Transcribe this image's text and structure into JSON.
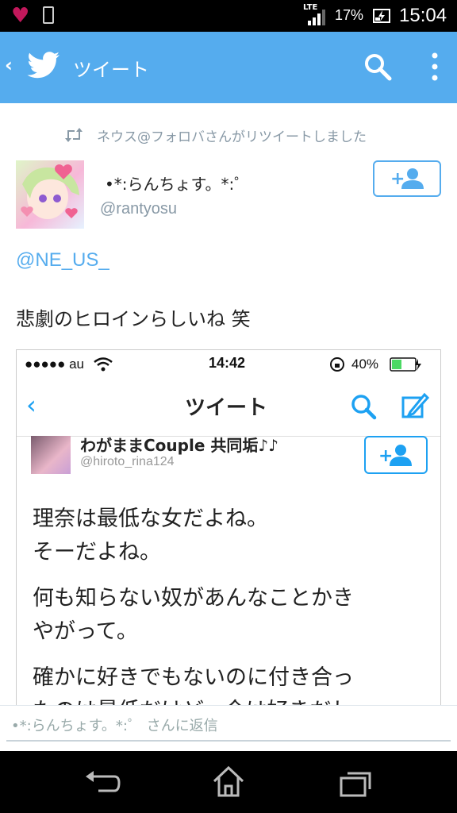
{
  "status_bar": {
    "network": "LTE",
    "battery_percent": "17%",
    "time": "15:04"
  },
  "app_bar": {
    "title": "ツイート",
    "icons": [
      "back-chevron",
      "twitter-bird",
      "search",
      "overflow-menu"
    ]
  },
  "tweet": {
    "retweet_notice": "ネウス@フォロバさんがリツイートしました",
    "display_name": "•*:らんちょす。*:゜",
    "handle": "@rantyosu",
    "mention": "@NE_US_",
    "text": "悲劇のヒロインらしいね 笑"
  },
  "embedded_screenshot": {
    "carrier": "●●●●● au",
    "time": "14:42",
    "battery_percent": "40%",
    "title": "ツイート",
    "user_name": "わがままCouple 共同垢♪♪",
    "user_handle": "@hiroto_rina124",
    "lines": [
      "理奈は最低な女だよね。",
      "そーだよね。",
      "何も知らない奴があんなことかき",
      "やがって。",
      "確かに好きでもないのに付き合っ",
      "たのは最低だけど、今は好きだし"
    ]
  },
  "reply_bar": {
    "placeholder": "•*:らんちょす。*:゜ さんに返信"
  },
  "colors": {
    "twitter_blue": "#55acee",
    "status_bar": "#000000",
    "nav_bar": "#000000",
    "secondary_text": "#8899a6"
  }
}
